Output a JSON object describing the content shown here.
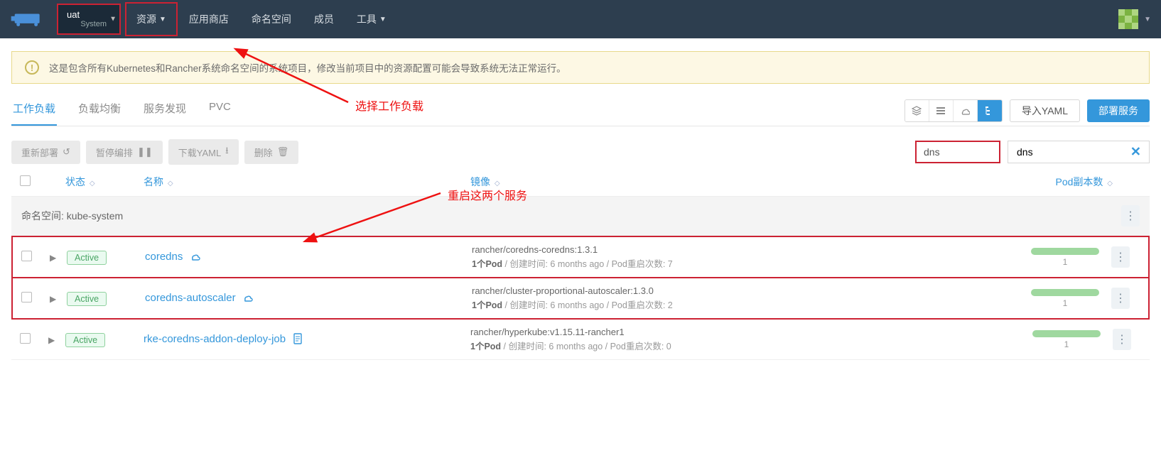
{
  "nav": {
    "env_main": "uat",
    "env_sub": "System",
    "items": [
      "资源",
      "应用商店",
      "命名空间",
      "成员",
      "工具"
    ],
    "items_caret": [
      true,
      false,
      false,
      false,
      true
    ]
  },
  "annotations": {
    "select_workload": "选择工作负载",
    "restart_services": "重启这两个服务"
  },
  "banner": {
    "text": "这是包含所有Kubernetes和Rancher系统命名空间的系统项目，修改当前项目中的资源配置可能会导致系统无法正常运行。"
  },
  "tabs": {
    "items": [
      "工作负载",
      "负载均衡",
      "服务发现",
      "PVC"
    ],
    "active_index": 0,
    "import_yaml": "导入YAML",
    "deploy": "部署服务"
  },
  "toolbar": {
    "redeploy": "重新部署",
    "pause": "暂停编排",
    "download_yaml": "下载YAML",
    "delete": "删除",
    "search_value": "dns"
  },
  "columns": {
    "state": "状态",
    "name": "名称",
    "image": "镜像",
    "pods": "Pod副本数"
  },
  "namespace": {
    "label": "命名空间: kube-system"
  },
  "rows": [
    {
      "state": "Active",
      "name": "coredns",
      "icon": "cloud",
      "image": "rancher/coredns-coredns:1.3.1",
      "pod_label": "1个Pod",
      "created_label": "创建时间",
      "created": "6 months ago",
      "restart_label": "Pod重启次数",
      "restarts": "7",
      "replica": "1",
      "highlighted": true
    },
    {
      "state": "Active",
      "name": "coredns-autoscaler",
      "icon": "cloud",
      "image": "rancher/cluster-proportional-autoscaler:1.3.0",
      "pod_label": "1个Pod",
      "created_label": "创建时间",
      "created": "6 months ago",
      "restart_label": "Pod重启次数",
      "restarts": "2",
      "replica": "1",
      "highlighted": true
    },
    {
      "state": "Active",
      "name": "rke-coredns-addon-deploy-job",
      "icon": "doc",
      "image": "rancher/hyperkube:v1.15.11-rancher1",
      "pod_label": "1个Pod",
      "created_label": "创建时间",
      "created": "6 months ago",
      "restart_label": "Pod重启次数",
      "restarts": "0",
      "replica": "1",
      "highlighted": false
    }
  ]
}
